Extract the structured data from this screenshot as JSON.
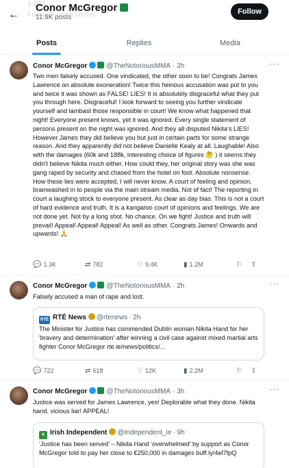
{
  "header": {
    "ghost_top": "1,232",
    "ghost_sub": "Follow    ltr    ctoria Derbis",
    "name": "Conor McGregor",
    "posts_count": "11.9K posts",
    "follow_label": "Follow",
    "back_icon": "arrow-left-icon"
  },
  "tabs": [
    {
      "label": "Posts"
    },
    {
      "label": "Replies"
    },
    {
      "label": "Media"
    }
  ],
  "posts": [
    {
      "name": "Conor McGregor",
      "handle": "@TheNotoriousMMA",
      "time": "· 2h",
      "text": "Two men falsely accused. One vindicated, the other soon to be! Congrats James Lawrence on absolute exoneration! Twice this heinous accusation was put to you and twice it was shown as FALSE! LIES! It is absolutely disgraceful what they put you through here. Disgraceful! I look forward to seeing you further vindicate yourself and lambast those responsible in court! We know what happened that night! Everyone present knows, yet it was ignored. Every single statement of persons present on the night was ignored. And they all disputed Nikita’s LIES! However James they did believe you but just in certain parts for some strange reason. And they apparently did not believe Danielle Kealy at all. Laughable! Also with the damages (60k and 188k, interesting choice of figures 🤔 ) it seems they didn’t believe Nikita much either. How could they, her original story was she was gang raped by security and chased from the hotel on foot. Absolute nonsense. How these lies were accepted, I will never know. A court of feeling and opinion, brainwashed in to people via the main stream media. Not of fact! The reporting in court a laughing stock to everyone present. As clear as day bias. This is not a court of hard evidence and truth. It is a kangaroo court of opinions and feelings. We are not done yet. Not by a long shot. No chance. On we fight! Justice and truth will prevail! Appeal! Appeal! Appeal! As well as other. Congrats James! Onwards and upwards! 🙏",
      "replies": "1.3K",
      "reposts": "782",
      "likes": "9.4K",
      "views": "1.2M"
    },
    {
      "name": "Conor McGregor",
      "handle": "@TheNotoriousMMA",
      "time": "· 2h",
      "text": "Falsely accused a man of rape and lost.",
      "quote": {
        "logo": "RTÉ",
        "name": "RTÉ News",
        "handle": "@rtenews",
        "time": "· 2h",
        "text": "The Minister for Justice has commended Dublin woman Nikita Hand for her 'bravery and determination' after winning a civil case against mixed martial arts fighter Conor McGregor rte.ie/news/politics/..."
      },
      "replies": "722",
      "reposts": "618",
      "likes": "12K",
      "views": "2.2M"
    },
    {
      "name": "Conor McGregor",
      "handle": "@TheNotoriousMMA",
      "time": "· 3h",
      "text": "Justice was served for James Lawrence, yes! Deplorable what they done. Nikita hand, vicious liar! APPEAL!",
      "quote": {
        "logo": "II",
        "name": "Irish Independent",
        "handle": "@Independent_ie",
        "time": "· 9h",
        "text": "‘Justice has been served’ – Nikita Hand ‘overwhelmed’ by support as Conor McGregor told to pay her close to €250,000 in damages buff.ly/4el7fpQ"
      }
    }
  ],
  "colors": {
    "accent": "#1d9bf0",
    "text": "#0f1419",
    "muted": "#536471",
    "flag_green": "#1a8a4a",
    "rte_blue": "#1d6fb8",
    "independent_green": "#2f8f3e"
  }
}
